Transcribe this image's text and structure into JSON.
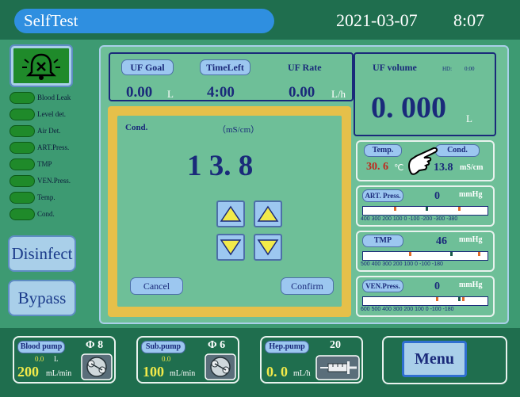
{
  "header": {
    "title": "SelfTest",
    "date": "2021-03-07",
    "time": "8:07"
  },
  "indicators": [
    {
      "label": "Blood Leak"
    },
    {
      "label": "Level det."
    },
    {
      "label": "Air Det."
    },
    {
      "label": "ART.Press."
    },
    {
      "label": "TMP"
    },
    {
      "label": "VEN.Press."
    },
    {
      "label": "Temp."
    },
    {
      "label": "Cond."
    }
  ],
  "side_buttons": {
    "disinfect": "Disinfect",
    "bypass": "Bypass"
  },
  "uf": {
    "goal_label": "UF Goal",
    "goal_value": "0.00",
    "goal_unit": "L",
    "timeleft_label": "TimeLeft",
    "timeleft_value": "4:00",
    "rate_label": "UF Rate",
    "rate_value": "0.00",
    "rate_unit": "L/h",
    "volume_label": "UF volume",
    "hd_label": "HD:",
    "hd_value": "0:00",
    "volume_value": "0. 000",
    "volume_unit": "L"
  },
  "dialog": {
    "label": "Cond.",
    "unit": "（mS/cm）",
    "value": "1 3. 8",
    "cancel": "Cancel",
    "confirm": "Confirm"
  },
  "temp_cond": {
    "temp_label": "Temp.",
    "temp_value": "30. 6",
    "temp_unit": "℃",
    "cond_label": "Cond.",
    "cond_value": "13.8",
    "cond_unit": "mS/cm"
  },
  "pressures": [
    {
      "label": "ART. Press.",
      "value": "0",
      "unit": "mmHg",
      "scale": "400 300 200 100  0  -100 -200 -300 -380"
    },
    {
      "label": "TMP",
      "value": "46",
      "unit": "mmHg",
      "scale": "500 400 300 200 100  0  -100 -180"
    },
    {
      "label": "VEN.Press.",
      "value": "0",
      "unit": "mmHg",
      "scale": "600 500 400 300 200 100  0  -100 -180"
    }
  ],
  "pumps": [
    {
      "label": "Blood  pump",
      "phi": "Φ 8",
      "small_value": "0.0",
      "small_unit": "L",
      "value": "200",
      "unit": "mL/min",
      "icon": "peristaltic-pump-icon"
    },
    {
      "label": "Sub.pump",
      "phi": "Φ 6",
      "small_value": "0.0",
      "small_unit": "",
      "value": "100",
      "unit": "mL/min",
      "icon": "peristaltic-pump-icon"
    },
    {
      "label": "Hep.pump",
      "phi": "20",
      "small_value": "",
      "small_unit": "",
      "value": "0. 0",
      "unit": "mL/h",
      "icon": "syringe-icon"
    }
  ],
  "menu_label": "Menu",
  "colors": {
    "header_bg": "#1f6e4e",
    "title_pill": "#2f8fe0",
    "panel": "#6ebf98",
    "dialog_border": "#e6c04a",
    "value_red": "#c0281e",
    "value_yellow": "#f2ea4a",
    "indicator_green": "#1f8a2a"
  }
}
